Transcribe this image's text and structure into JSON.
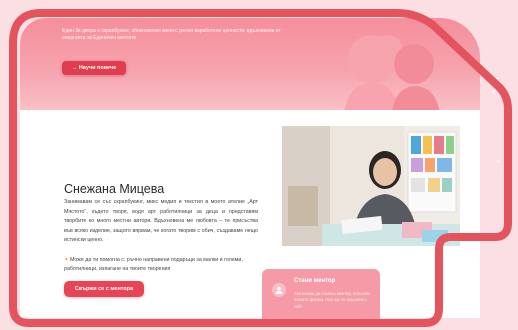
{
  "hero": {
    "intro_text": "Един 3в двора е скрапбукинг, обикновенко меня с ръчно изработени ценности, вдъхновени от енергията за Еднничен мечтите",
    "button_label": "→ Научи повече"
  },
  "mentor": {
    "name": "Снежана Мицева",
    "bio": "Занимавам се със скрапбукинг, микс медия и текстил в моето ателие „Арт Мястото“, където творя, водя арт работилници за деца и представям творбите ко много местни автори. Вдъхновена ме любовта – те присъства във всяко изделие, защото вярвам, че когато творим с обич, създаваме нещо истински ценно.",
    "help_text": "Може да ти помогна с: ръчно направени подаръци за малки и големи, работилници, изпагане на твоите творения",
    "contact_button": "Свържи се с ментора"
  },
  "become_mentor": {
    "title": "Стани ментор",
    "text": "Ако искаш да станеш ментор, попълни нашата форма. Ние ще се свържем с теб!"
  },
  "colors": {
    "accent": "#e84457",
    "hero_top": "#f58f9c",
    "frame": "#e3545f",
    "card": "#f59aa6"
  }
}
